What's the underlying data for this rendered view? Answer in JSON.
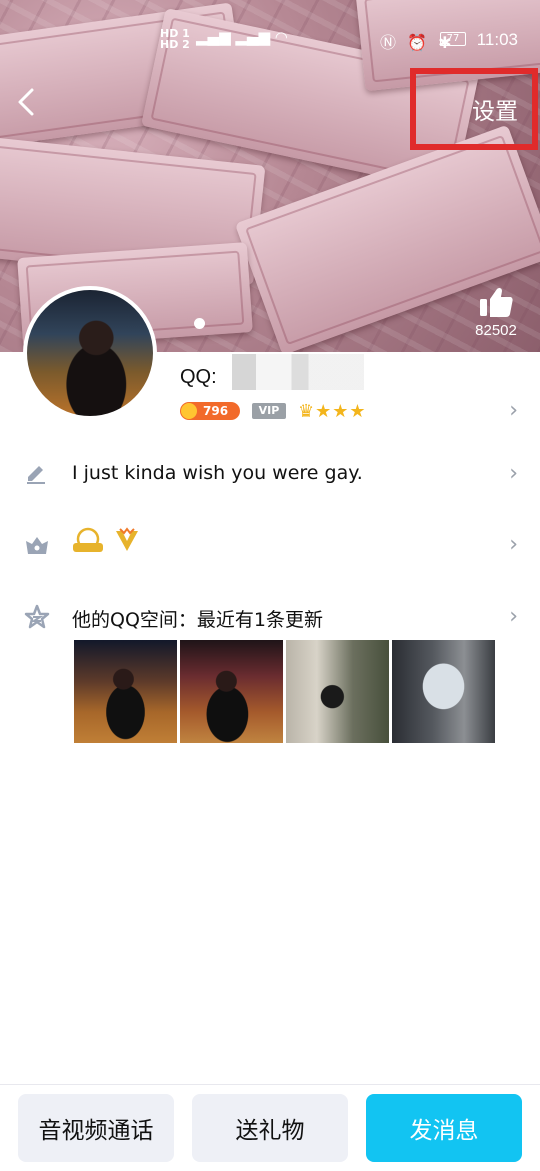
{
  "status_bar": {
    "time": "11:03",
    "battery": "77",
    "signal_label_top": "HD 1",
    "signal_label_bottom": "HD 2"
  },
  "header": {
    "settings_label": "设置",
    "likes_count": "82502"
  },
  "profile": {
    "qq_label": "QQ:",
    "level_badge": "796",
    "vip_label": "VIP",
    "stars": "★★★"
  },
  "rows": {
    "signature": "I just kinda wish you were gay.",
    "qzone": "他的QQ空间：最近有1条更新"
  },
  "bottom_bar": {
    "call_label": "音视频通话",
    "gift_label": "送礼物",
    "message_label": "发消息"
  },
  "icons": {
    "back": "chevron-left-icon",
    "like": "thumbs-up-icon",
    "edit": "pencil-icon",
    "gift": "gift-box-icon",
    "qzone": "star-icon",
    "row_arrow": "chevron-right-icon"
  },
  "colors": {
    "accent_blue": "#12c4f2",
    "highlight_red": "#e02b2b",
    "coin_orange": "#f26a2a",
    "star_gold": "#f3b51c"
  }
}
